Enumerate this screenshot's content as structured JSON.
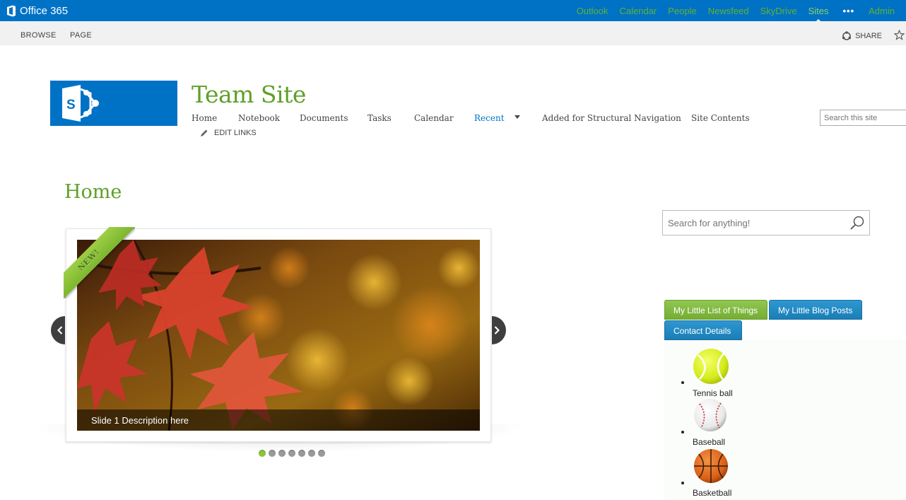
{
  "suitebar": {
    "brand": "Office 365",
    "links": [
      "Outlook",
      "Calendar",
      "People",
      "Newsfeed",
      "SkyDrive",
      "Sites"
    ],
    "selected": "Sites",
    "more": "•••",
    "user": "Admin"
  },
  "ribbon": {
    "browse": "BROWSE",
    "page": "PAGE",
    "share": "SHARE"
  },
  "site": {
    "title": "Team Site",
    "nav": [
      "Home",
      "Notebook",
      "Documents",
      "Tasks",
      "Calendar",
      "Recent",
      "Added for Structural Navigation",
      "Site Contents"
    ],
    "edit_links": "EDIT LINKS",
    "search_placeholder": "Search this site"
  },
  "page": {
    "title": "Home"
  },
  "slider": {
    "badge": "NEW!",
    "caption": "Slide 1 Description here",
    "slide_count": 7,
    "active_slide": 1
  },
  "sidebar": {
    "search_placeholder": "Search for anything!",
    "tabs": [
      "My Little List of Things",
      "My Little Blog Posts",
      "Contact Details"
    ],
    "items": [
      "Tennis ball",
      "Baseball",
      "Basketball"
    ]
  },
  "colors": {
    "suitebar": "#0072c6",
    "suite_link": "#5fb32c",
    "title_green": "#5fa028",
    "tab_green": "#7db62f",
    "tab_blue": "#1a7db6"
  }
}
